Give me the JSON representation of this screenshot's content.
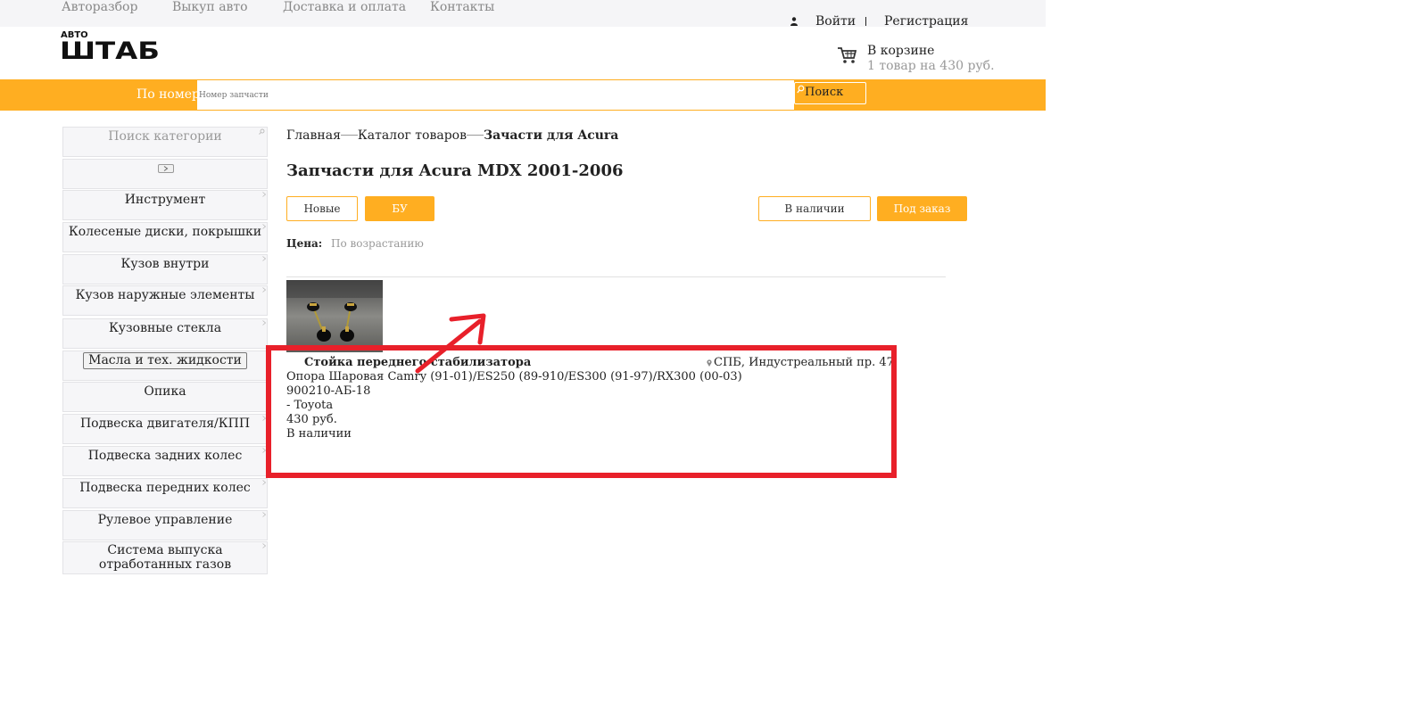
{
  "topnav": {
    "items": [
      "Авторазбор",
      "Выкуп авто",
      "Доставка и оплата",
      "Контакты"
    ],
    "login": "Войти",
    "register": "Регистрация"
  },
  "logo": {
    "small": "АВТО",
    "big": "ШТАБ"
  },
  "cart": {
    "title": "В корзине",
    "summary": "1 товар на 430 руб."
  },
  "search": {
    "mode_label": "По номеру",
    "placeholder": "Номер запчасти",
    "button_label": "Поиск"
  },
  "sidebar": {
    "search_placeholder": "Поиск категории",
    "categories": [
      "Инструмент",
      "Колесеные диски, покрышки",
      "Кузов внутри",
      "Кузов наружные элементы",
      "Кузовные стекла",
      "Масла и тех. жидкости",
      "Опика",
      "Подвеска двигателя/КПП",
      "Подвеска задних колес",
      "Подвеска передних колес",
      "Рулевое управление",
      "Система выпуска отработанных газов"
    ],
    "active_index": 5
  },
  "breadcrumb": [
    "Главная",
    "Каталог товаров",
    "Зачасти для Acura"
  ],
  "page_title": "Запчасти для Acura MDX 2001-2006",
  "filters": {
    "condition": [
      "Новые",
      "БУ"
    ],
    "condition_active": "БУ",
    "availability": [
      "В наличии",
      "Под заказ"
    ],
    "availability_active": "Под заказ"
  },
  "sort": {
    "label": "Цена:",
    "value": "По возрастанию"
  },
  "product": {
    "name": "Стойка переднего стабилизатора",
    "description": "Опора Шаровая Camry (91-01)/ES250 (89-910/ES300 (91-97)/RX300 (00-03)",
    "code": "900210-АБ-18",
    "brand": "- Toyota",
    "price": "430 руб.",
    "stock": "В наличии",
    "location": "СПБ, Индустреальный пр. 47"
  },
  "colors": {
    "accent": "#ffae21",
    "annotation": "#e8202a",
    "topbar": "#f5f5f7"
  }
}
